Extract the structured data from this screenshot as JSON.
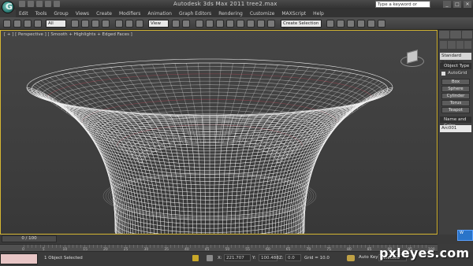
{
  "app": {
    "title": "Autodesk 3ds Max  2011      tree2.max",
    "logo_letter": "G",
    "search_placeholder": "Type a keyword or phrase",
    "window_controls": [
      "_",
      "□",
      "✕"
    ]
  },
  "menu": [
    "Edit",
    "Tools",
    "Group",
    "Views",
    "Create",
    "Modifiers",
    "Animation",
    "Graph Editors",
    "Rendering",
    "Customize",
    "MAXScript",
    "Help"
  ],
  "toolbar": {
    "filter_select": "All",
    "coord_select": "View",
    "selection_set": "Create Selection Se"
  },
  "viewport": {
    "label": "[ + ] [ Perspective ] [ Smooth + Highlights + Edged Faces ]",
    "object": "Bowl wireframe mesh",
    "wire_color": "#f2f2f2",
    "background": "#404040",
    "active_border_color": "#d5b632"
  },
  "command_panel": {
    "category": "Standard Primitives",
    "object_type_header": "Object Type",
    "autogrid": "AutoGrid",
    "object_buttons": [
      "Box",
      "Sphere",
      "Cylinder",
      "Torus",
      "Teapot"
    ],
    "name_header": "Name and Color",
    "name_value": "Arc001"
  },
  "timeline": {
    "frame_display": "0 / 100",
    "tick_labels": [
      "0",
      "5",
      "10",
      "15",
      "20",
      "25",
      "30",
      "35",
      "40",
      "45",
      "50",
      "55",
      "60",
      "65",
      "70",
      "75",
      "80",
      "85",
      "90",
      "95",
      "100"
    ]
  },
  "status": {
    "selection_text": "1 Object Selected",
    "x_label": "X:",
    "x_value": "221.707",
    "y_label": "Y:",
    "y_value": "100.488",
    "z_label": "Z:",
    "z_value": "0.0",
    "grid_text": "Grid = 10.0",
    "auto_key": "Auto Key",
    "key_mode": "Selected"
  },
  "watermark": {
    "text": "pxleyes.com",
    "tag": "W"
  }
}
